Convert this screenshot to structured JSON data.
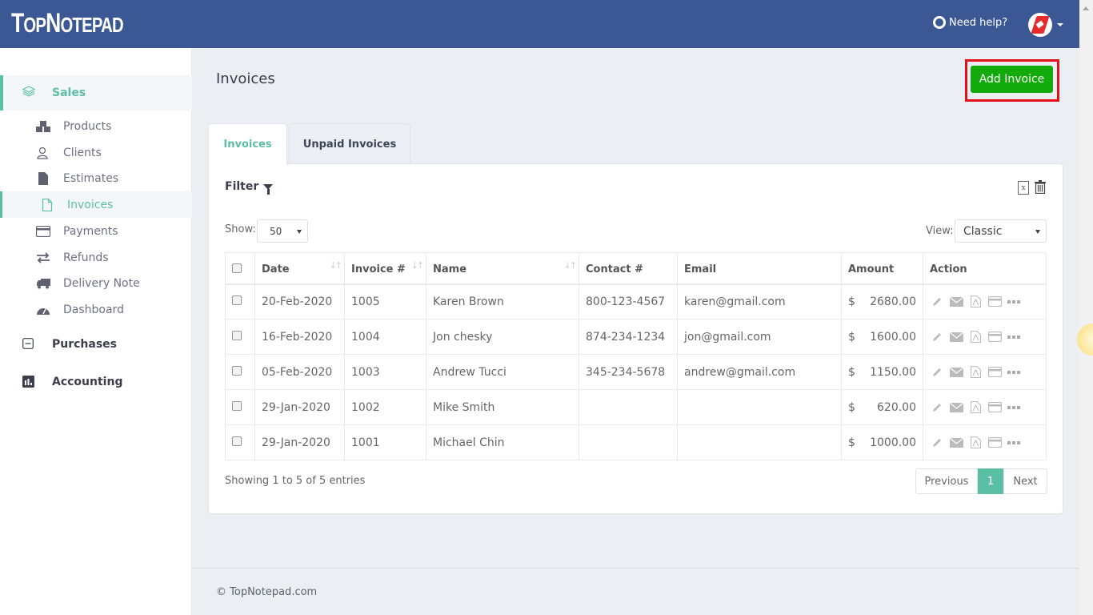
{
  "header": {
    "logo": "TopNotepad",
    "help_label": "Need help?"
  },
  "sidebar": {
    "sales": "Sales",
    "sub_items": [
      {
        "label": "Products",
        "icon": "cubes-icon"
      },
      {
        "label": "Clients",
        "icon": "users-icon"
      },
      {
        "label": "Estimates",
        "icon": "file-icon"
      },
      {
        "label": "Invoices",
        "icon": "file-outline-icon",
        "active": true
      },
      {
        "label": "Payments",
        "icon": "credit-card-icon"
      },
      {
        "label": "Refunds",
        "icon": "exchange-icon"
      },
      {
        "label": "Delivery Note",
        "icon": "truck-icon"
      },
      {
        "label": "Dashboard",
        "icon": "dashboard-icon"
      }
    ],
    "purchases": "Purchases",
    "accounting": "Accounting"
  },
  "main": {
    "title": "Invoices",
    "add_button": "Add Invoice",
    "tabs": [
      {
        "label": "Invoices",
        "active": true
      },
      {
        "label": "Unpaid Invoices",
        "active": false
      }
    ],
    "filter_label": "Filter",
    "show_label": "Show:",
    "show_value": "50",
    "view_label": "View:",
    "view_value": "Classic",
    "columns": [
      "Date",
      "Invoice #",
      "Name",
      "Contact #",
      "Email",
      "Amount",
      "Action"
    ],
    "rows": [
      {
        "date": "20-Feb-2020",
        "invoice": "1005",
        "name": "Karen Brown",
        "contact": "800-123-4567",
        "email": "karen@gmail.com",
        "currency": "$",
        "amount": "2680.00"
      },
      {
        "date": "16-Feb-2020",
        "invoice": "1004",
        "name": "Jon chesky",
        "contact": "874-234-1234",
        "email": "jon@gmail.com",
        "currency": "$",
        "amount": "1600.00"
      },
      {
        "date": "05-Feb-2020",
        "invoice": "1003",
        "name": "Andrew Tucci",
        "contact": "345-234-5678",
        "email": "andrew@gmail.com",
        "currency": "$",
        "amount": "1150.00"
      },
      {
        "date": "29-Jan-2020",
        "invoice": "1002",
        "name": "Mike Smith",
        "contact": "",
        "email": "",
        "currency": "$",
        "amount": "620.00"
      },
      {
        "date": "29-Jan-2020",
        "invoice": "1001",
        "name": "Michael Chin",
        "contact": "",
        "email": "",
        "currency": "$",
        "amount": "1000.00"
      }
    ],
    "showing_text": "Showing 1 to 5 of 5 entries",
    "pagination": {
      "previous": "Previous",
      "current": "1",
      "next": "Next"
    }
  },
  "footer": {
    "text": "© TopNotepad.com"
  },
  "colors": {
    "header": "#3b5895",
    "accent": "#5bbfa4",
    "add_button": "#13ab0c",
    "highlight_border": "#e3101b"
  }
}
